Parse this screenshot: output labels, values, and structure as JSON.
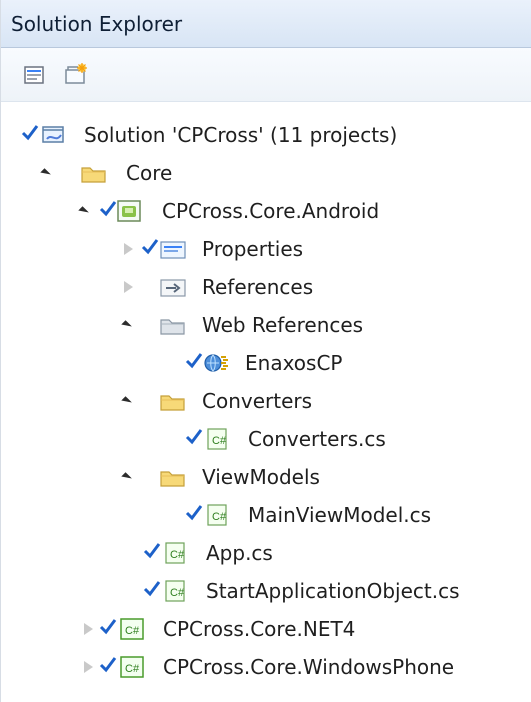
{
  "window": {
    "title": "Solution Explorer"
  },
  "toolbar": {
    "buttons": [
      {
        "icon": "properties-icon"
      },
      {
        "icon": "show-all-files-icon"
      }
    ]
  },
  "tree": {
    "items": [
      {
        "label": "Solution 'CPCross' (11 projects)",
        "icon": "solution-icon",
        "expanded": null,
        "checked": true
      },
      {
        "label": "Core",
        "icon": "folder-icon",
        "expanded": true,
        "checked": false
      },
      {
        "label": "CPCross.Core.Android",
        "icon": "android-project-icon",
        "expanded": true,
        "checked": true
      },
      {
        "label": "Properties",
        "icon": "properties-folder-icon",
        "expanded": false,
        "checked": true
      },
      {
        "label": "References",
        "icon": "references-icon",
        "expanded": false,
        "checked": false
      },
      {
        "label": "Web References",
        "icon": "web-references-folder-icon",
        "expanded": true,
        "checked": false
      },
      {
        "label": "EnaxosCP",
        "icon": "web-service-icon",
        "expanded": null,
        "checked": true
      },
      {
        "label": "Converters",
        "icon": "folder-open-icon",
        "expanded": true,
        "checked": false
      },
      {
        "label": "Converters.cs",
        "icon": "csharp-file-icon",
        "expanded": null,
        "checked": true
      },
      {
        "label": "ViewModels",
        "icon": "folder-open-icon",
        "expanded": true,
        "checked": false
      },
      {
        "label": "MainViewModel.cs",
        "icon": "csharp-file-icon",
        "expanded": null,
        "checked": true
      },
      {
        "label": "App.cs",
        "icon": "csharp-file-icon",
        "expanded": null,
        "checked": true
      },
      {
        "label": "StartApplicationObject.cs",
        "icon": "csharp-file-icon",
        "expanded": null,
        "checked": true
      },
      {
        "label": "CPCross.Core.NET4",
        "icon": "csharp-project-icon",
        "expanded": false,
        "checked": true
      },
      {
        "label": "CPCross.Core.WindowsPhone",
        "icon": "csharp-project-icon",
        "expanded": false,
        "checked": true
      }
    ]
  },
  "colors": {
    "title_bg": "#d8e5f5",
    "selection": "#dbeafe",
    "check": "#1d61c9",
    "folder": "#f2c957",
    "csharp": "#4a9c2c"
  }
}
